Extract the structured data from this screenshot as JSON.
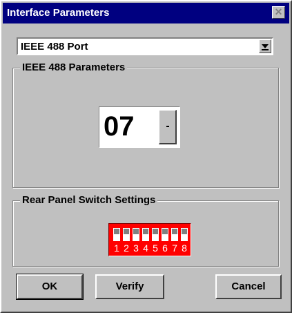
{
  "window": {
    "title": "Interface Parameters",
    "close_glyph": "✕"
  },
  "port": {
    "selected": "IEEE 488 Port"
  },
  "ieee_group": {
    "label": "IEEE 488 Parameters",
    "address_value": "07",
    "button_glyph": "-"
  },
  "switch_group": {
    "label": "Rear Panel Switch Settings",
    "numbers": [
      "1",
      "2",
      "3",
      "4",
      "5",
      "6",
      "7",
      "8"
    ],
    "switch_color": "#ff0000"
  },
  "buttons": {
    "ok": "OK",
    "verify": "Verify",
    "cancel": "Cancel"
  }
}
